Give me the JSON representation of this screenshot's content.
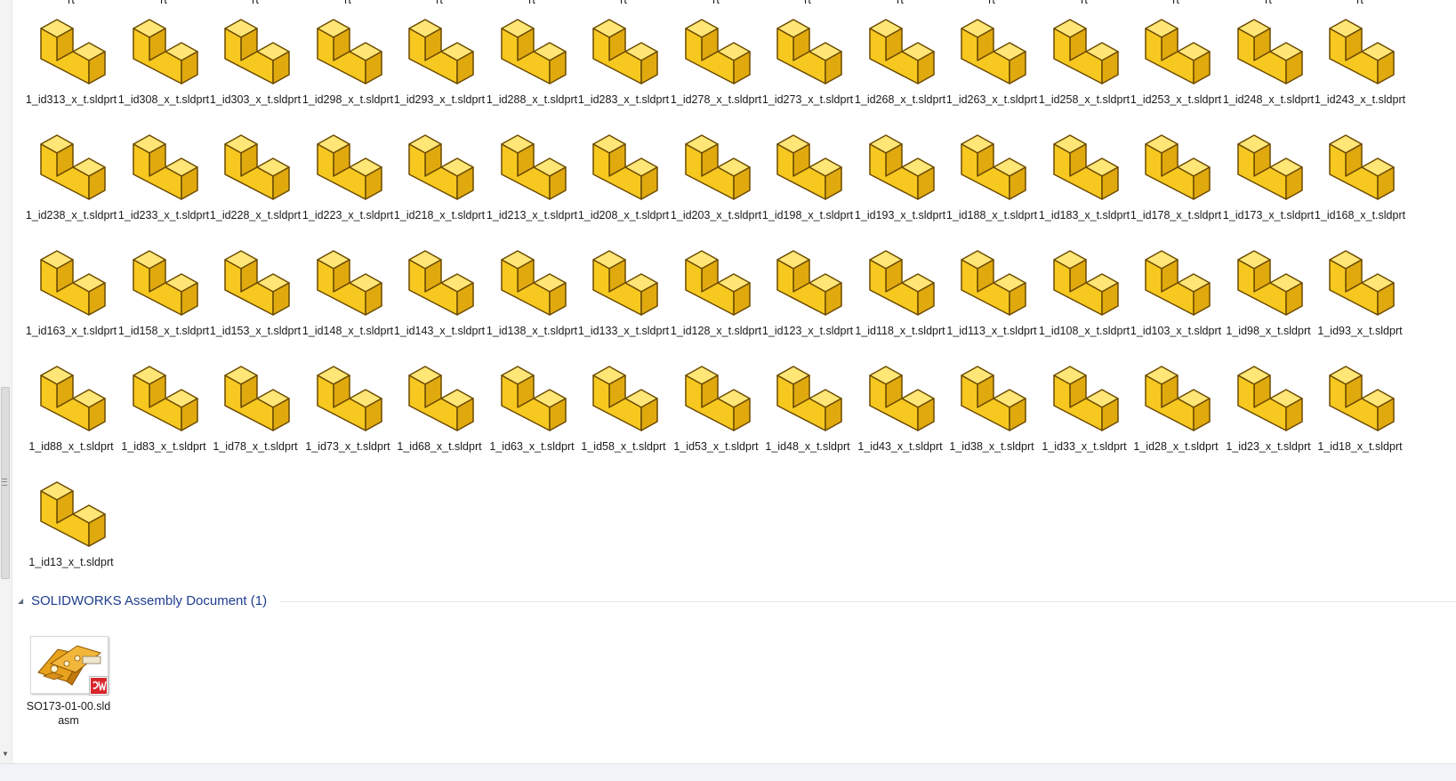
{
  "groups": [
    {
      "title": "SOLIDWORKS Assembly Document (1)",
      "items": [
        {
          "name": "SO173-01-00.sldasm",
          "icon": "solidworks-assembly-thumbnail"
        }
      ]
    }
  ],
  "cut_off_row_labels": [
    "rt",
    "rt",
    "rt",
    "rt",
    "rt",
    "rt",
    "rt",
    "rt",
    "rt",
    "rt",
    "rt",
    "rt",
    "rt",
    "rt",
    "rt"
  ],
  "parts": [
    "1_id313_x_t.sldprt",
    "1_id308_x_t.sldprt",
    "1_id303_x_t.sldprt",
    "1_id298_x_t.sldprt",
    "1_id293_x_t.sldprt",
    "1_id288_x_t.sldprt",
    "1_id283_x_t.sldprt",
    "1_id278_x_t.sldprt",
    "1_id273_x_t.sldprt",
    "1_id268_x_t.sldprt",
    "1_id263_x_t.sldprt",
    "1_id258_x_t.sldprt",
    "1_id253_x_t.sldprt",
    "1_id248_x_t.sldprt",
    "1_id243_x_t.sldprt",
    "1_id238_x_t.sldprt",
    "1_id233_x_t.sldprt",
    "1_id228_x_t.sldprt",
    "1_id223_x_t.sldprt",
    "1_id218_x_t.sldprt",
    "1_id213_x_t.sldprt",
    "1_id208_x_t.sldprt",
    "1_id203_x_t.sldprt",
    "1_id198_x_t.sldprt",
    "1_id193_x_t.sldprt",
    "1_id188_x_t.sldprt",
    "1_id183_x_t.sldprt",
    "1_id178_x_t.sldprt",
    "1_id173_x_t.sldprt",
    "1_id168_x_t.sldprt",
    "1_id163_x_t.sldprt",
    "1_id158_x_t.sldprt",
    "1_id153_x_t.sldprt",
    "1_id148_x_t.sldprt",
    "1_id143_x_t.sldprt",
    "1_id138_x_t.sldprt",
    "1_id133_x_t.sldprt",
    "1_id128_x_t.sldprt",
    "1_id123_x_t.sldprt",
    "1_id118_x_t.sldprt",
    "1_id113_x_t.sldprt",
    "1_id108_x_t.sldprt",
    "1_id103_x_t.sldprt",
    "1_id98_x_t.sldprt",
    "1_id93_x_t.sldprt",
    "1_id88_x_t.sldprt",
    "1_id83_x_t.sldprt",
    "1_id78_x_t.sldprt",
    "1_id73_x_t.sldprt",
    "1_id68_x_t.sldprt",
    "1_id63_x_t.sldprt",
    "1_id58_x_t.sldprt",
    "1_id53_x_t.sldprt",
    "1_id48_x_t.sldprt",
    "1_id43_x_t.sldprt",
    "1_id38_x_t.sldprt",
    "1_id33_x_t.sldprt",
    "1_id28_x_t.sldprt",
    "1_id23_x_t.sldprt",
    "1_id18_x_t.sldprt",
    "1_id13_x_t.sldprt"
  ],
  "part_icon": "solidworks-part-icon",
  "colors": {
    "part_face_top": "#ffe676",
    "part_face_front": "#f7c81f",
    "part_face_side": "#e0a90e",
    "part_outline": "#6b4a00",
    "group_title": "#1e3d8f",
    "badge_red": "#d6262b"
  }
}
